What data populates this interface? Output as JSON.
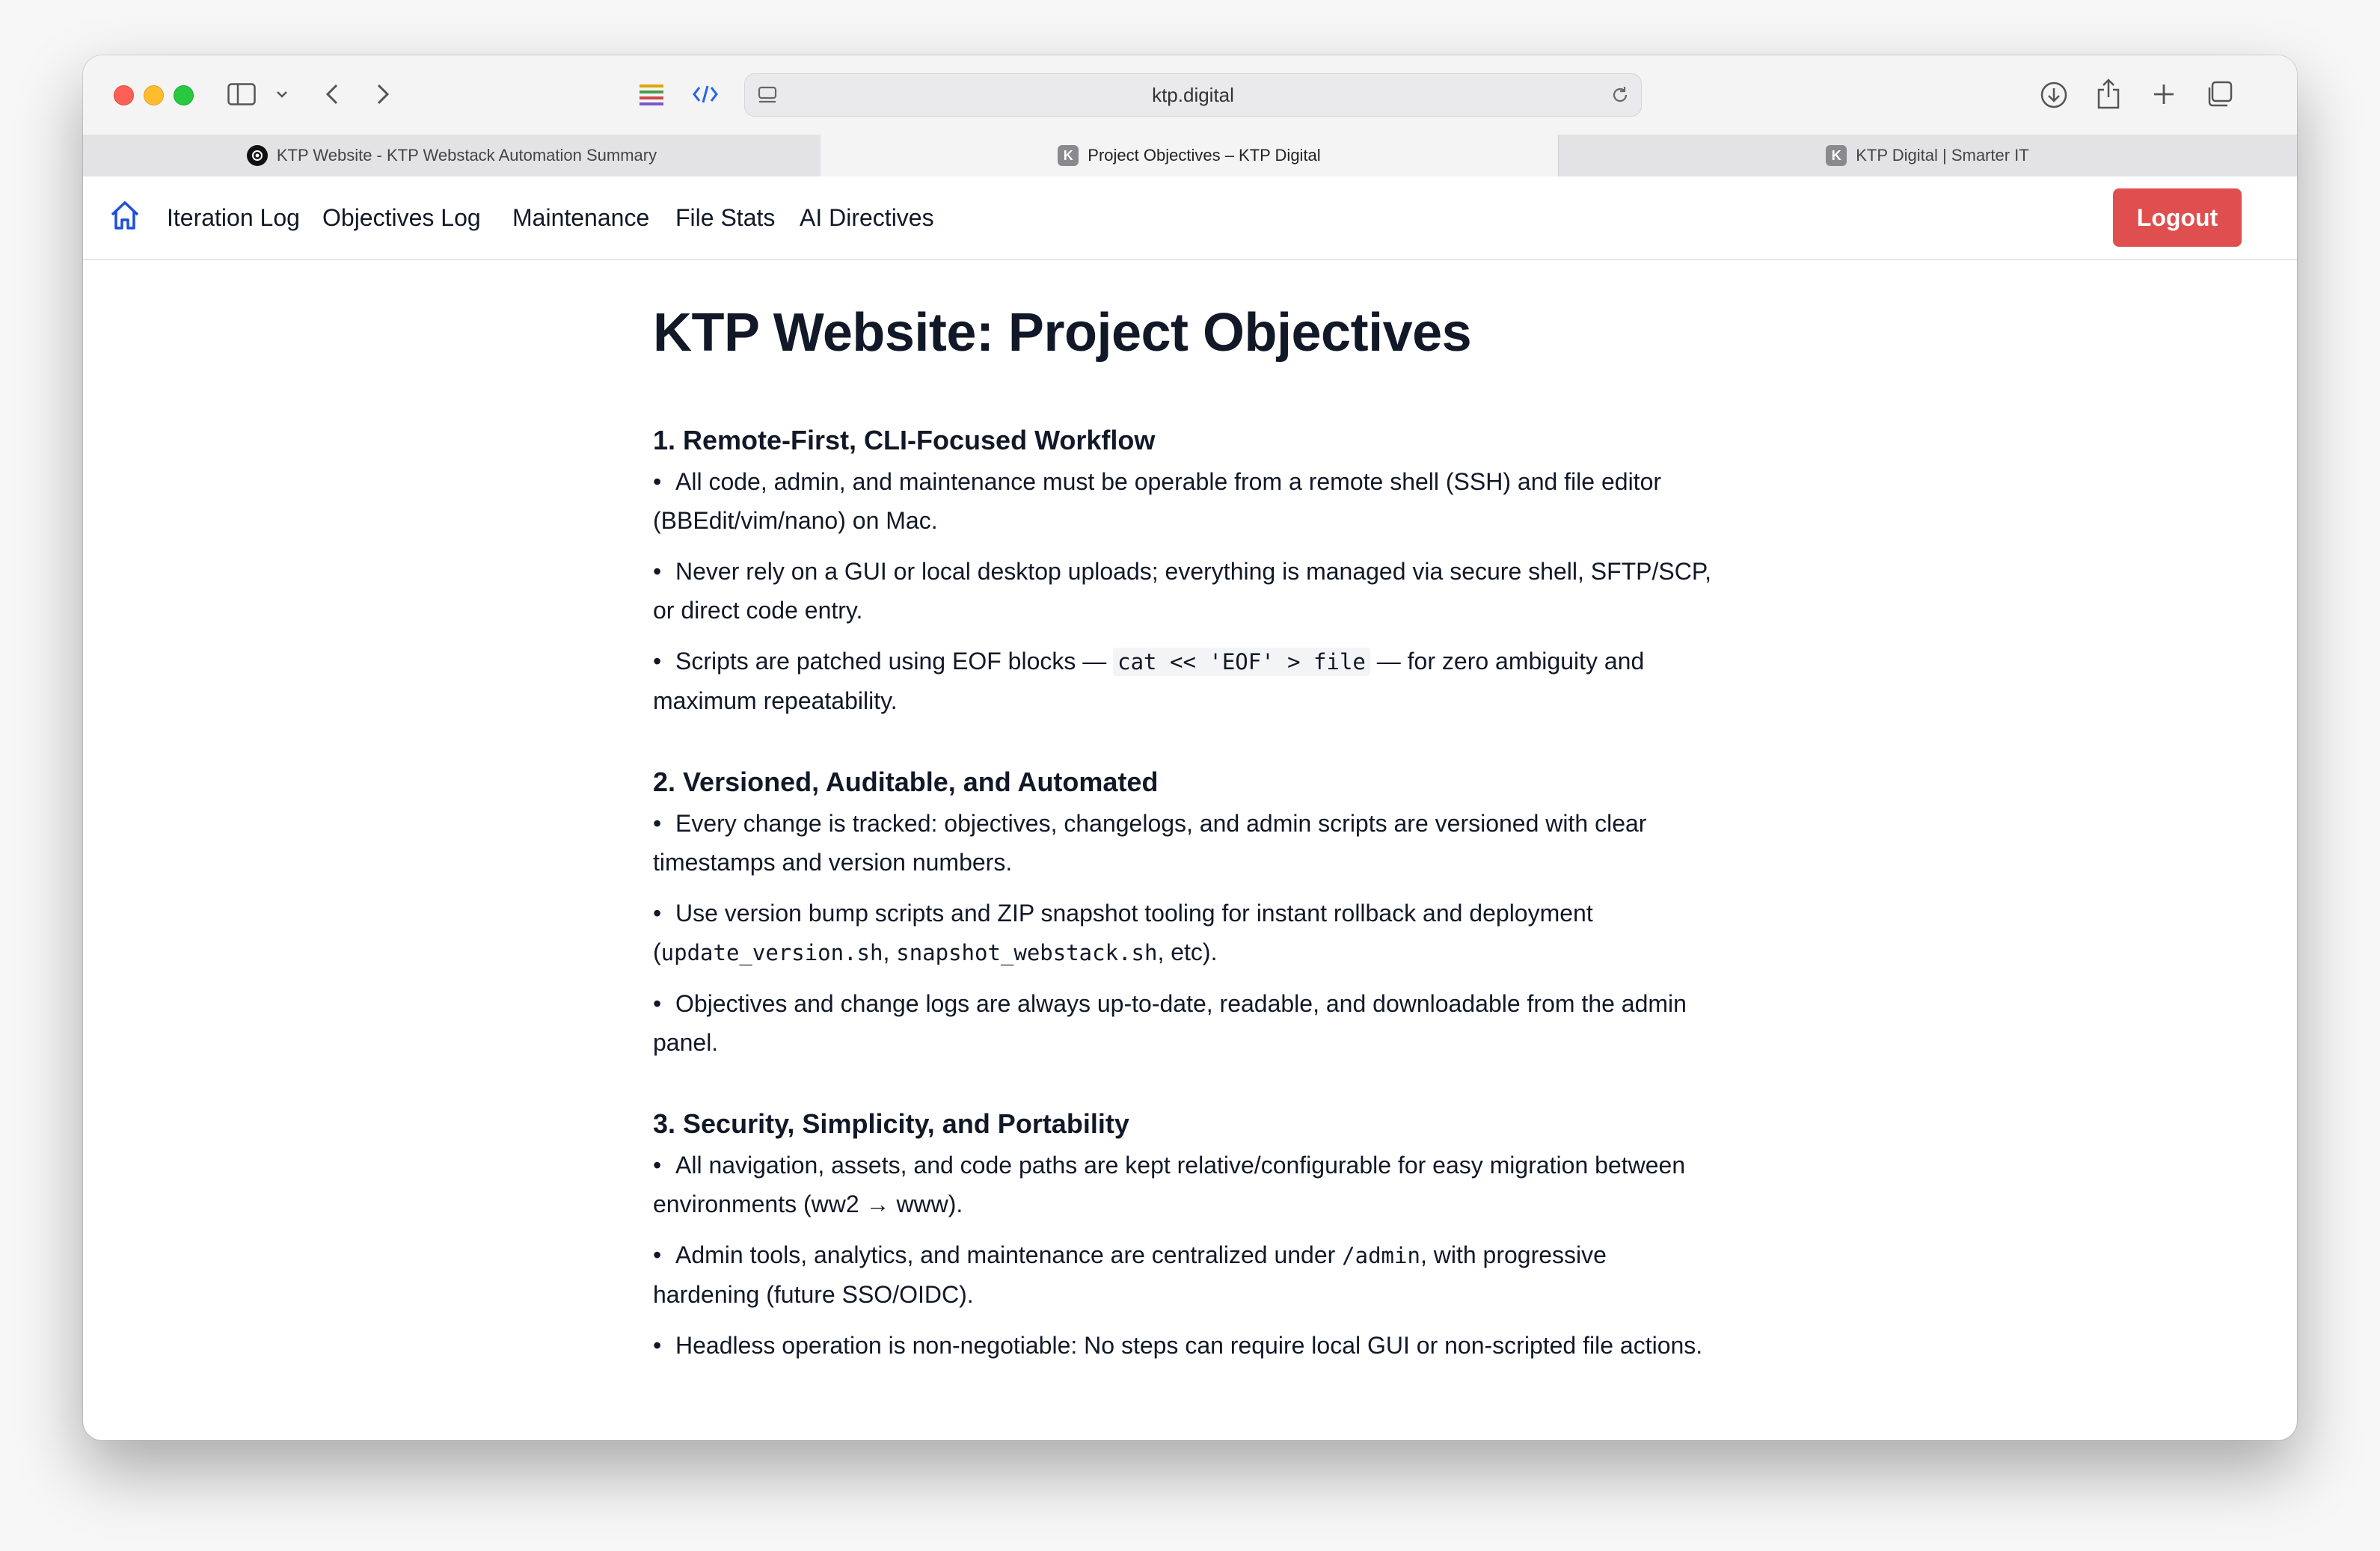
{
  "browser": {
    "url": "ktp.digital",
    "tabs": [
      {
        "label": "KTP Website - KTP Webstack Automation Summary",
        "active": false
      },
      {
        "label": "Project Objectives – KTP Digital",
        "active": true
      },
      {
        "label": "KTP Digital | Smarter IT",
        "active": false
      }
    ]
  },
  "nav": {
    "links": [
      "Iteration Log",
      "Objectives Log",
      "Maintenance",
      "File Stats",
      "AI Directives"
    ],
    "logout": "Logout",
    "accent": "#1d4ed8",
    "logout_color": "#e04f4f"
  },
  "page": {
    "title": "KTP Website: Project Objectives",
    "sections": [
      {
        "title": "1. Remote-First, CLI-Focused Workflow",
        "b1": "All code, admin, and maintenance must be operable from a remote shell (SSH) and file editor (BBEdit/vim/nano) on Mac.",
        "b2": "Never rely on a GUI or local desktop uploads; everything is managed via secure shell, SFTP/SCP, or direct code entry.",
        "b3_pre": "Scripts are patched using EOF blocks — ",
        "b3_code": "cat << 'EOF' > file",
        "b3_post": " — for zero ambiguity and maximum repeatability."
      },
      {
        "title": "2. Versioned, Auditable, and Automated",
        "b1": "Every change is tracked: objectives, changelogs, and admin scripts are versioned with clear timestamps and version numbers.",
        "b2_pre": "Use version bump scripts and ZIP snapshot tooling for instant rollback and deployment (",
        "b2_code1": "update_version.sh",
        "b2_mid": ", ",
        "b2_code2": "snapshot_webstack.sh",
        "b2_post": ", etc).",
        "b3": "Objectives and change logs are always up-to-date, readable, and downloadable from the admin panel."
      },
      {
        "title": "3. Security, Simplicity, and Portability",
        "b1_pre": "All navigation, assets, and code paths are kept relative/configurable for easy migration between environments (",
        "b1_code": "ww2 → www",
        "b1_post": ").",
        "b2_pre": "Admin tools, analytics, and maintenance are centralized under ",
        "b2_code": "/admin",
        "b2_post": ", with progressive hardening (future SSO/OIDC).",
        "b3": "Headless operation is non-negotiable: No steps can require local GUI or non-scripted file actions."
      }
    ]
  }
}
